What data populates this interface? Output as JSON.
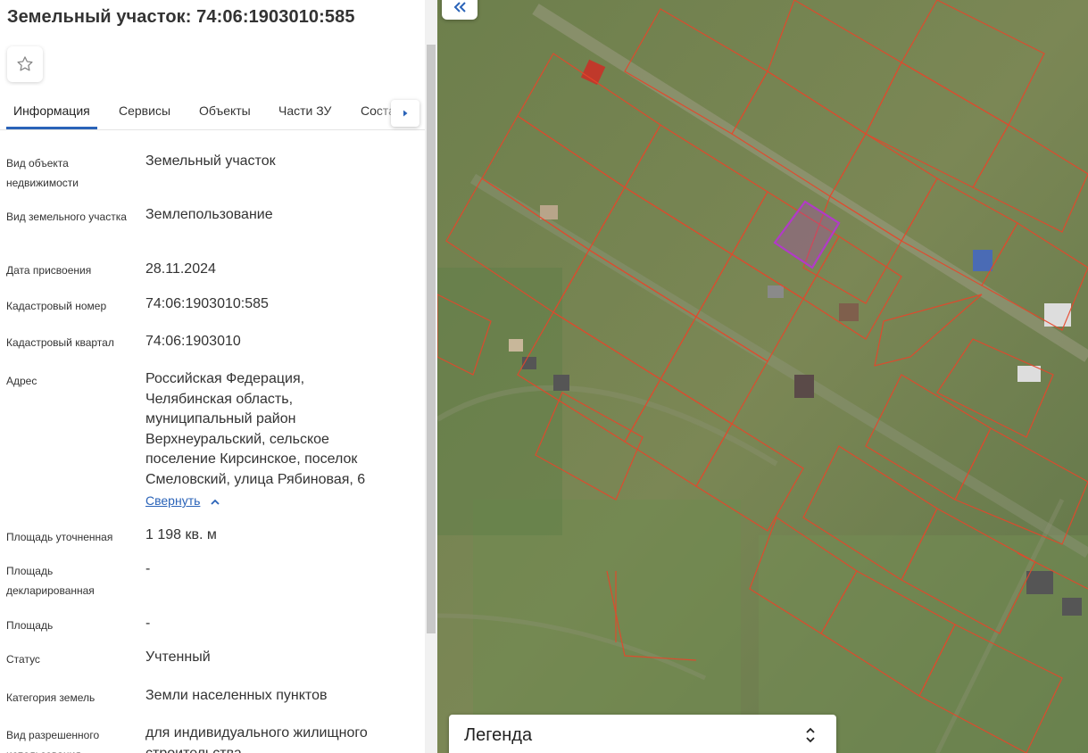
{
  "header": {
    "title": "Земельный участок: 74:06:1903010:585",
    "favorite_icon": "star-icon"
  },
  "tabs": [
    "Информация",
    "Сервисы",
    "Объекты",
    "Части ЗУ",
    "Соста"
  ],
  "tabs_next_icon": "arrow-right-icon",
  "info": {
    "object_type_label": "Вид объекта недвижимости",
    "object_type": "Земельный участок",
    "land_type_label": "Вид земельного участка",
    "land_type": "Землепользование",
    "assign_date_label": "Дата присвоения",
    "assign_date": "28.11.2024",
    "cad_number_label": "Кадастровый номер",
    "cad_number": "74:06:1903010:585",
    "cad_block_label": "Кадастровый квартал",
    "cad_block": "74:06:1903010",
    "address_label": "Адрес",
    "address": "Российская Федерация, Челябинская область, муниципальный район Верхнеуральский, сельское поселение Кирсинское, поселок Смеловский, улица Рябиновая, 6",
    "collapse_link": "Свернуть",
    "area_spec_label": "Площадь уточненная",
    "area_spec": "1 198 кв. м",
    "area_decl_label": "Площадь декларированная",
    "area_decl": "-",
    "area_label": "Площадь",
    "area": "-",
    "status_label": "Статус",
    "status": "Учтенный",
    "category_label": "Категория земель",
    "category": "Земли населенных пунктов",
    "permitted_use_label": "Вид разрешенного использования",
    "permitted_use": "для индивидуального жилищного строительства"
  },
  "map": {
    "collapse_icon": "double-chevron-left-icon",
    "legend_title": "Легенда",
    "legend_icon": "chevron-up-down-icon",
    "parcel_line_color": "#e8452a",
    "selected_parcel_color": "#b23ac8"
  },
  "colors": {
    "accent": "#2a63b8",
    "text": "#333333"
  }
}
